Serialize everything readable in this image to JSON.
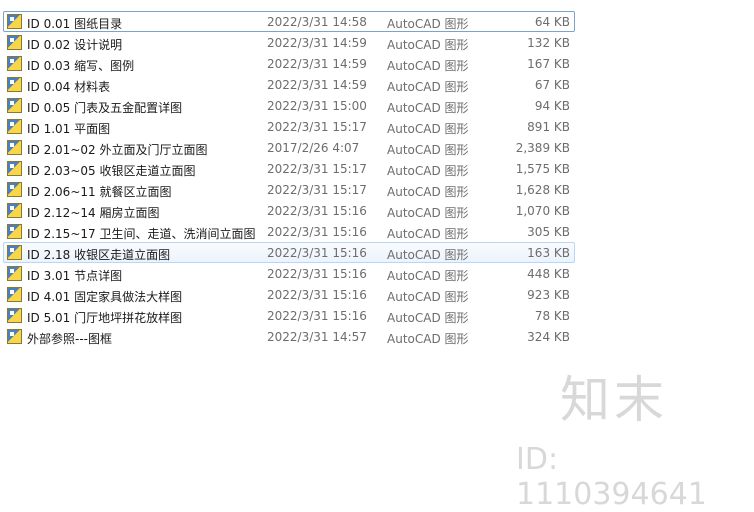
{
  "files": [
    {
      "name": "ID 0.01 图纸目录",
      "date": "2022/3/31 14:58",
      "type": "AutoCAD 图形",
      "size": "64 KB"
    },
    {
      "name": "ID 0.02 设计说明",
      "date": "2022/3/31 14:59",
      "type": "AutoCAD 图形",
      "size": "132 KB"
    },
    {
      "name": "ID 0.03 缩写、图例",
      "date": "2022/3/31 14:59",
      "type": "AutoCAD 图形",
      "size": "167 KB"
    },
    {
      "name": "ID 0.04 材料表",
      "date": "2022/3/31 14:59",
      "type": "AutoCAD 图形",
      "size": "67 KB"
    },
    {
      "name": "ID 0.05 门表及五金配置详图",
      "date": "2022/3/31 15:00",
      "type": "AutoCAD 图形",
      "size": "94 KB"
    },
    {
      "name": "ID 1.01 平面图",
      "date": "2022/3/31 15:17",
      "type": "AutoCAD 图形",
      "size": "891 KB"
    },
    {
      "name": "ID 2.01~02 外立面及门厅立面图",
      "date": "2017/2/26 4:07",
      "type": "AutoCAD 图形",
      "size": "2,389 KB"
    },
    {
      "name": "ID 2.03~05 收银区走道立面图",
      "date": "2022/3/31 15:17",
      "type": "AutoCAD 图形",
      "size": "1,575 KB"
    },
    {
      "name": "ID 2.06~11 就餐区立面图",
      "date": "2022/3/31 15:17",
      "type": "AutoCAD 图形",
      "size": "1,628 KB"
    },
    {
      "name": "ID 2.12~14 厢房立面图",
      "date": "2022/3/31 15:16",
      "type": "AutoCAD 图形",
      "size": "1,070 KB"
    },
    {
      "name": "ID 2.15~17 卫生间、走道、洗消间立面图",
      "date": "2022/3/31 15:16",
      "type": "AutoCAD 图形",
      "size": "305 KB"
    },
    {
      "name": "ID 2.18 收银区走道立面图",
      "date": "2022/3/31 15:16",
      "type": "AutoCAD 图形",
      "size": "163 KB"
    },
    {
      "name": "ID 3.01 节点详图",
      "date": "2022/3/31 15:16",
      "type": "AutoCAD 图形",
      "size": "448 KB"
    },
    {
      "name": "ID 4.01 固定家具做法大样图",
      "date": "2022/3/31 15:16",
      "type": "AutoCAD 图形",
      "size": "923 KB"
    },
    {
      "name": "ID 5.01 门厅地坪拼花放样图",
      "date": "2022/3/31 15:16",
      "type": "AutoCAD 图形",
      "size": "78 KB"
    },
    {
      "name": "外部参照---图框",
      "date": "2022/3/31 14:57",
      "type": "AutoCAD 图形",
      "size": "324 KB"
    }
  ],
  "focused_index": 0,
  "hover_index": 11,
  "watermark": {
    "logo": "知末",
    "id": "ID: 1110394641"
  }
}
